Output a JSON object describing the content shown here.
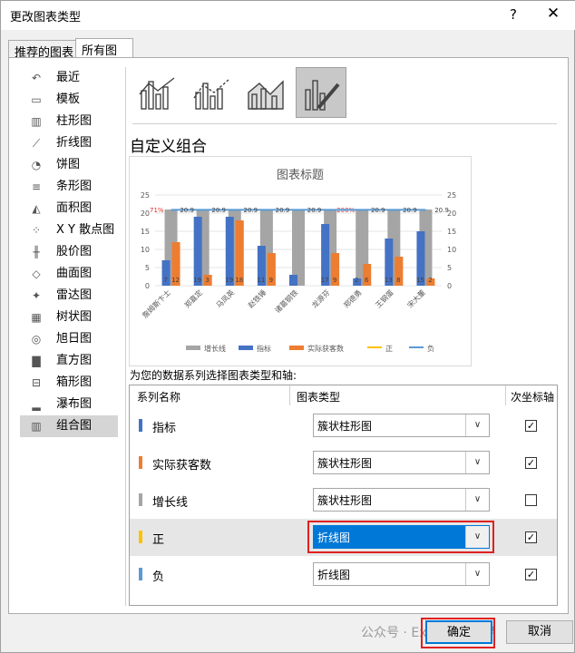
{
  "dialog": {
    "title": "更改图表类型",
    "help": "?",
    "close": "✕",
    "tabs": [
      "推荐的图表",
      "所有图表"
    ]
  },
  "categories": [
    {
      "label": "最近",
      "icon": "recent-icon"
    },
    {
      "label": "模板",
      "icon": "folder-icon"
    },
    {
      "label": "柱形图",
      "icon": "column-chart-icon"
    },
    {
      "label": "折线图",
      "icon": "line-chart-icon"
    },
    {
      "label": "饼图",
      "icon": "pie-chart-icon"
    },
    {
      "label": "条形图",
      "icon": "bar-chart-icon"
    },
    {
      "label": "面积图",
      "icon": "area-chart-icon"
    },
    {
      "label": "X Y 散点图",
      "icon": "scatter-chart-icon"
    },
    {
      "label": "股价图",
      "icon": "stock-chart-icon"
    },
    {
      "label": "曲面图",
      "icon": "surface-chart-icon"
    },
    {
      "label": "雷达图",
      "icon": "radar-chart-icon"
    },
    {
      "label": "树状图",
      "icon": "treemap-chart-icon"
    },
    {
      "label": "旭日图",
      "icon": "sunburst-chart-icon"
    },
    {
      "label": "直方图",
      "icon": "histogram-chart-icon"
    },
    {
      "label": "箱形图",
      "icon": "box-chart-icon"
    },
    {
      "label": "瀑布图",
      "icon": "waterfall-chart-icon"
    },
    {
      "label": "组合图",
      "icon": "combo-chart-icon"
    }
  ],
  "selected_category": "组合图",
  "section_title": "自定义组合",
  "preview": {
    "title": "图表标题",
    "categories": [
      "詹姆斯卞士",
      "郑嘉定",
      "马凤英",
      "赵铁锤",
      "诸葛钢铁",
      "龙源芬",
      "郑德勇",
      "王钢蛋",
      "宋大董"
    ],
    "pct_labels": [
      "71%",
      "",
      "",
      "",
      "",
      "",
      "200%",
      "",
      ""
    ],
    "pct_color": "#e0302d",
    "line_labels": [
      "",
      "20.9",
      "20.9",
      "20.9",
      "20.9",
      "20.9",
      "",
      "20.9",
      "20.9",
      "20.9"
    ],
    "bar_labels_blue": [
      "7",
      "19",
      "19",
      "11",
      "",
      "17",
      "2",
      "13",
      "15"
    ],
    "bar_labels_orange": [
      "12",
      "3",
      "18",
      "9",
      "",
      "9",
      "6",
      "8",
      "2"
    ],
    "y_ticks": [
      "0",
      "5",
      "10",
      "15",
      "20",
      "25"
    ],
    "legend": [
      "增长线",
      "指标",
      "实际获客数",
      "正",
      "负"
    ],
    "colors": {
      "grey": "#a5a5a5",
      "blue": "#4472c4",
      "orange": "#ed7d31",
      "yellow": "#ffc000",
      "lightblue": "#5b9bd5"
    }
  },
  "chart_data": {
    "type": "bar",
    "title": "图表标题",
    "categories": [
      "詹姆斯卞士",
      "郑嘉定",
      "马凤英",
      "赵铁锤",
      "诸葛钢铁",
      "龙源芬",
      "郑德勇",
      "王钢蛋",
      "宋大董"
    ],
    "series": [
      {
        "name": "增长线",
        "values": [
          21,
          21,
          21,
          21,
          21,
          21,
          21,
          21,
          21
        ]
      },
      {
        "name": "指标",
        "values": [
          7,
          19,
          19,
          11,
          3,
          17,
          2,
          13,
          15
        ]
      },
      {
        "name": "实际获客数",
        "values": [
          12,
          3,
          18,
          9,
          0,
          9,
          6,
          8,
          2
        ]
      },
      {
        "name": "负",
        "values": [
          20.9,
          20.9,
          20.9,
          20.9,
          20.9,
          20.9,
          20.9,
          20.9,
          20.9
        ]
      }
    ],
    "ylim": [
      0,
      25
    ],
    "y2lim": [
      0,
      25
    ]
  },
  "prompt": "为您的数据系列选择图表类型和轴:",
  "table": {
    "headers": [
      "系列名称",
      "图表类型",
      "次坐标轴"
    ],
    "rows": [
      {
        "name": "指标",
        "color": "#4472c4",
        "type": "簇状柱形图",
        "secondary": true
      },
      {
        "name": "实际获客数",
        "color": "#ed7d31",
        "type": "簇状柱形图",
        "secondary": true
      },
      {
        "name": "增长线",
        "color": "#a5a5a5",
        "type": "簇状柱形图",
        "secondary": false
      },
      {
        "name": "正",
        "color": "#ffc000",
        "type": "折线图",
        "secondary": true
      },
      {
        "name": "负",
        "color": "#5b9bd5",
        "type": "折线图",
        "secondary": true
      }
    ]
  },
  "buttons": {
    "ok": "确定",
    "cancel": "取消"
  },
  "watermark": "公众号 · Excel学习世界"
}
